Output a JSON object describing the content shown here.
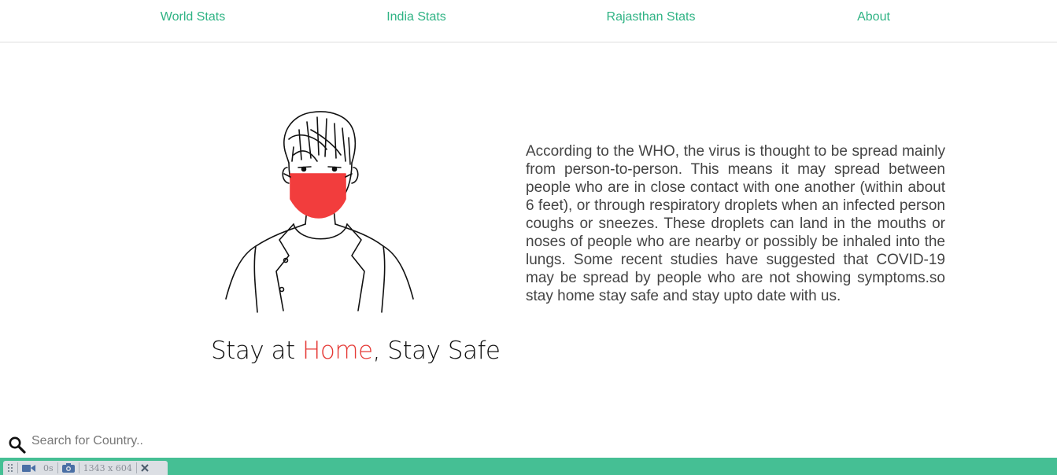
{
  "nav": {
    "items": [
      {
        "label": "World Stats"
      },
      {
        "label": "India Stats"
      },
      {
        "label": "Rajasthan Stats"
      },
      {
        "label": "About"
      }
    ]
  },
  "hero": {
    "tagline_part1": "Stay at ",
    "tagline_highlight": "Home",
    "tagline_part2": ", Stay Safe",
    "highlight_color": "#e53935",
    "mask_color": "#f23d3d",
    "description": "According to the WHO, the virus is thought to be spread mainly from person-to-person. This means it may spread between people who are in close contact with one another (within about 6 feet), or through respiratory droplets when an infected person coughs or sneezes. These droplets can land in the mouths or noses of people who are nearby or possibly be inhaled into the lungs. Some recent studies have suggested that COVID-19 may be spread by people who are not showing symptoms.so stay home stay safe and stay upto date with us."
  },
  "search": {
    "icon": "search-icon",
    "placeholder": "Search for Country.."
  },
  "footer": {
    "bar_color": "#45bf94",
    "devtools": {
      "timer": "0s",
      "resolution": "1343 x 604"
    }
  },
  "colors": {
    "accent": "#2fb384"
  }
}
